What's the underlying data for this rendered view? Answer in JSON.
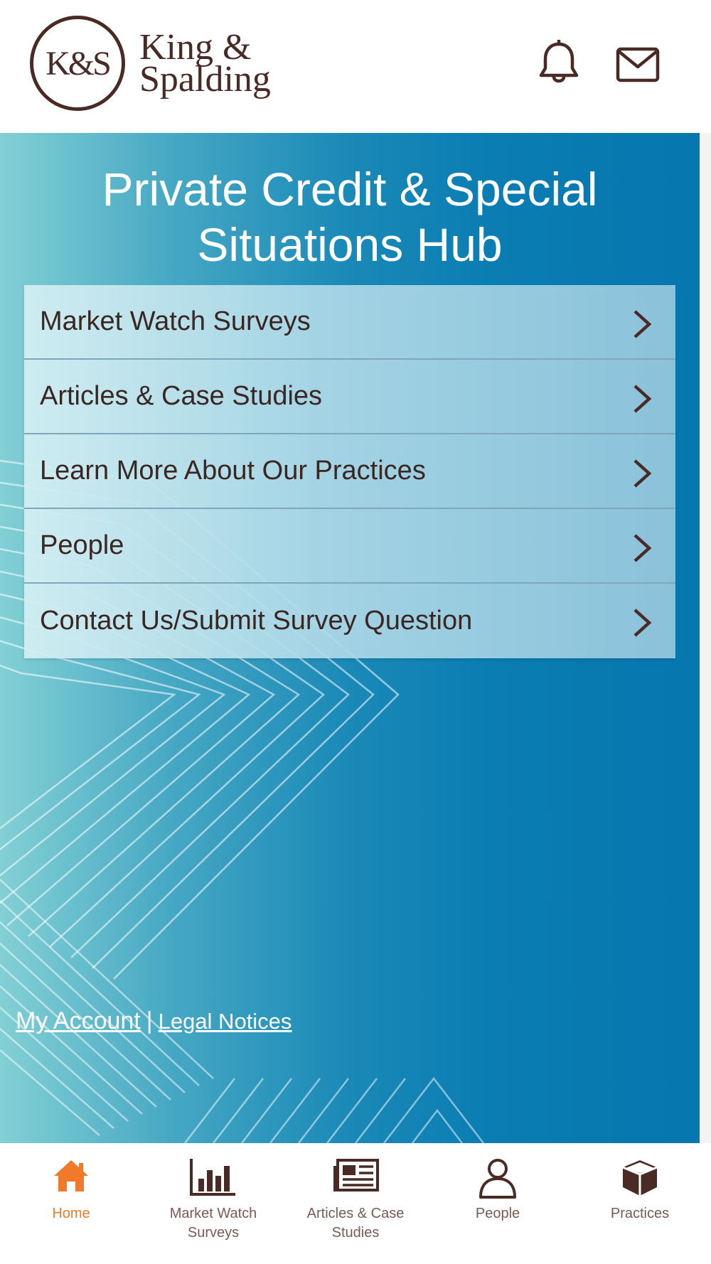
{
  "brand": {
    "mark": "K&S",
    "name_line1": "King &",
    "name_line2": "Spalding",
    "text_color": "#4a2a24"
  },
  "header": {
    "icons": [
      "bell-icon",
      "mail-icon"
    ]
  },
  "hero": {
    "title_line1": "Private Credit & Special",
    "title_line2": "Situations Hub",
    "gradient": [
      "#82d0d4",
      "#0677af"
    ]
  },
  "menu": {
    "items": [
      {
        "label": "Market Watch Surveys",
        "icon": "chevron-right-icon"
      },
      {
        "label": "Articles & Case Studies",
        "icon": "chevron-right-icon"
      },
      {
        "label": "Learn More About Our Practices",
        "icon": "chevron-right-icon"
      },
      {
        "label": "People",
        "icon": "chevron-right-icon"
      },
      {
        "label": "Contact Us/Submit Survey Question",
        "icon": "chevron-right-icon"
      }
    ]
  },
  "footer": {
    "my_account": "My Account",
    "separator": "|",
    "legal_notices": "Legal Notices"
  },
  "tabbar": {
    "accent": "#f07a2a",
    "inactive": "#7a5a52",
    "tabs": [
      {
        "label": "Home",
        "icon": "home-icon",
        "active": true
      },
      {
        "label": "Market Watch\nSurveys",
        "icon": "bar-chart-icon",
        "active": false
      },
      {
        "label": "Articles & Case\nStudies",
        "icon": "newspaper-icon",
        "active": false
      },
      {
        "label": "People",
        "icon": "person-icon",
        "active": false
      },
      {
        "label": "Practices",
        "icon": "cube-icon",
        "active": false
      }
    ]
  }
}
